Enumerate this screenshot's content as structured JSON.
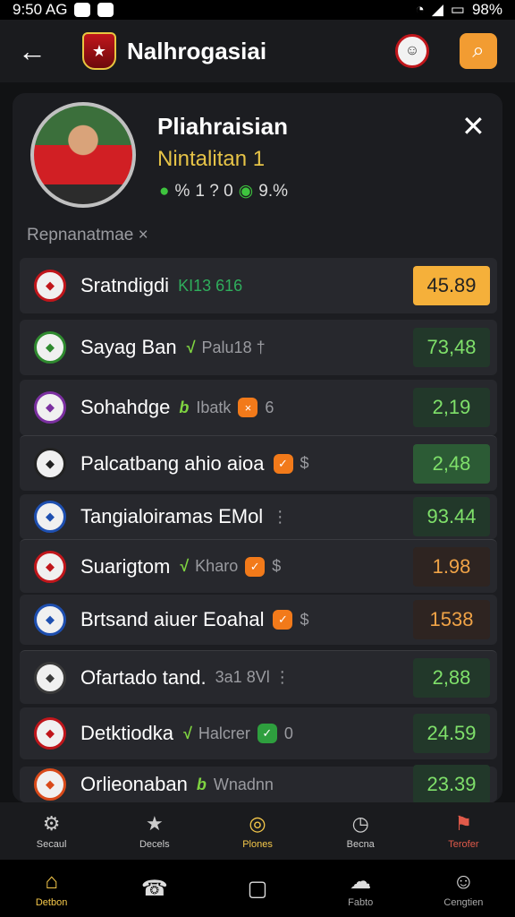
{
  "status": {
    "time": "9:50 AG",
    "battery": "98%"
  },
  "header": {
    "title": "Nalhrogasiai"
  },
  "player": {
    "name": "Pliahraisian",
    "subtitle": "Nintalitan 1",
    "stats": [
      "%",
      "1 ? 0",
      "9.%"
    ]
  },
  "section_label": "Repnanatmae ×",
  "matches": [
    {
      "team": "Sratndigdi",
      "meta_code": "KI13 616",
      "odds": "45.89",
      "odds_style": "hi",
      "crest_color": "#c0161b"
    },
    {
      "team": "Sayag Ban",
      "meta_v": "√",
      "meta_text": "Palu18 †",
      "odds": "73,48",
      "odds_style": "dk",
      "crest_color": "#2f8a2f"
    },
    {
      "team": "Sohahdge",
      "meta_v": "b",
      "meta_text": "Ibatk",
      "meta_tag": "×",
      "meta_num": "6",
      "odds": "2,19",
      "odds_style": "dk",
      "crest_color": "#7b2fa0"
    },
    {
      "team": "Palcatbang ahio aioa",
      "meta_tag": "✓",
      "meta_num": "$",
      "odds": "2,48",
      "odds_style": "bright",
      "crest_color": "#222"
    },
    {
      "team": "Tangialoiramas EMol",
      "meta_text": "⋮",
      "odds": "93.44",
      "odds_style": "dk",
      "crest_color": "#1e4fb0"
    },
    {
      "team": "Suarigtom",
      "meta_v": "√",
      "meta_text": "Kharo",
      "meta_tag": "✓",
      "meta_num": "$",
      "odds": "1.98",
      "odds_style": "red",
      "crest_color": "#c0161b"
    },
    {
      "team": "Brtsand aiuer Eoahal",
      "meta_tag": "✓",
      "meta_num": "$",
      "odds": "1538",
      "odds_style": "red",
      "crest_color": "#1e4fb0"
    },
    {
      "team": "Ofartado tand.",
      "meta_text": "3a1 8Vl ⋮",
      "odds": "2,88",
      "odds_style": "dk",
      "crest_color": "#3a3a3a"
    },
    {
      "team": "Detktiodka",
      "meta_v": "√",
      "meta_text": "Halcrer",
      "meta_tag": "✓",
      "meta_tag_green": true,
      "meta_num": "0",
      "odds": "24.59",
      "odds_style": "dk",
      "crest_color": "#c0161b"
    },
    {
      "team": "Orlieonaban",
      "meta_v": "b",
      "meta_text": "Wnadnn",
      "odds": "23.39",
      "odds_style": "dk",
      "crest_color": "#d94a1a"
    }
  ],
  "tabs": [
    {
      "label": "Secaul",
      "icon": "⚙"
    },
    {
      "label": "Decels",
      "icon": "★"
    },
    {
      "label": "Plones",
      "icon": "◎",
      "active": true
    },
    {
      "label": "Becna",
      "icon": "◷"
    },
    {
      "label": "Terofer",
      "icon": "⚑",
      "alert": true
    }
  ],
  "sys_nav": [
    {
      "label": "Detbon",
      "icon": "⌂",
      "active": true
    },
    {
      "label": "",
      "icon": "☎"
    },
    {
      "label": "",
      "icon": "▢"
    },
    {
      "label": "Fabto",
      "icon": "☁"
    },
    {
      "label": "Cengtien",
      "icon": "☺"
    }
  ]
}
